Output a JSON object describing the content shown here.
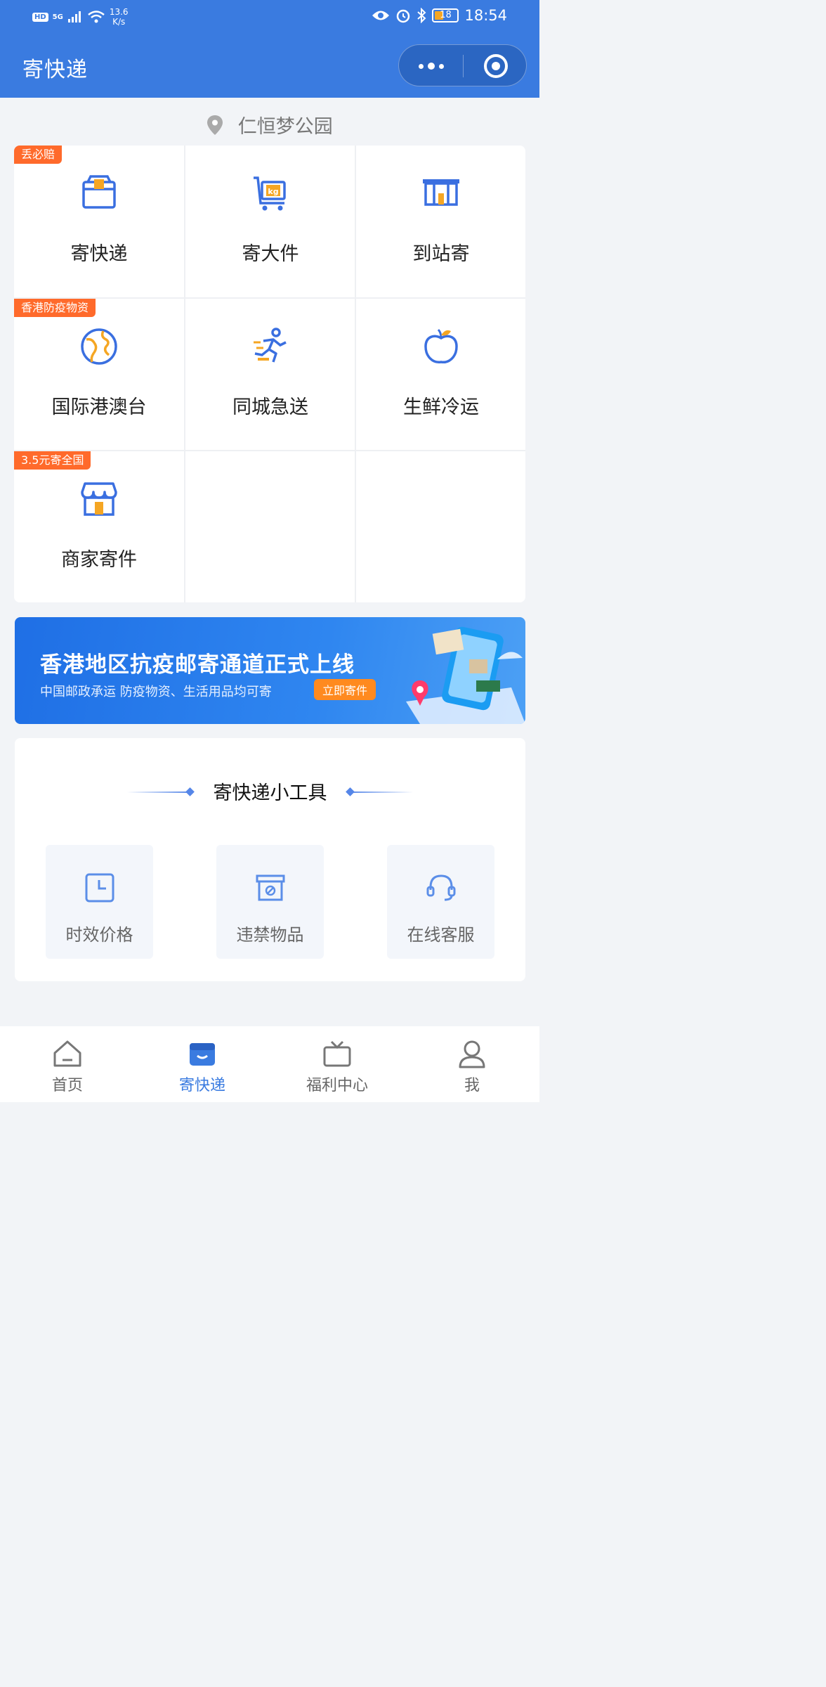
{
  "status_bar": {
    "hd": "HD",
    "network": "5G",
    "speed_top": "13.6",
    "speed_bottom": "K/s",
    "battery": "18",
    "time": "18:54"
  },
  "header": {
    "title": "寄快递"
  },
  "location": {
    "name": "仁恒梦公园"
  },
  "services": [
    {
      "label": "寄快递",
      "tag": "丢必赔",
      "icon": "box-icon"
    },
    {
      "label": "寄大件",
      "tag": "",
      "icon": "cart-kg-icon"
    },
    {
      "label": "到站寄",
      "tag": "",
      "icon": "station-icon"
    },
    {
      "label": "国际港澳台",
      "tag": "香港防疫物资",
      "icon": "globe-icon"
    },
    {
      "label": "同城急送",
      "tag": "",
      "icon": "runner-icon"
    },
    {
      "label": "生鲜冷运",
      "tag": "",
      "icon": "apple-icon"
    },
    {
      "label": "商家寄件",
      "tag": "3.5元寄全国",
      "icon": "shop-icon"
    }
  ],
  "banner": {
    "headline": "香港地区抗疫邮寄通道正式上线",
    "subline": "中国邮政承运 防疫物资、生活用品均可寄",
    "button": "立即寄件"
  },
  "tools": {
    "title": "寄快递小工具",
    "items": [
      {
        "label": "时效价格",
        "icon": "clock-icon"
      },
      {
        "label": "违禁物品",
        "icon": "prohibited-box-icon"
      },
      {
        "label": "在线客服",
        "icon": "headset-icon"
      }
    ]
  },
  "nav": [
    {
      "label": "首页",
      "icon": "home-icon",
      "active": false
    },
    {
      "label": "寄快递",
      "icon": "parcel-icon",
      "active": true
    },
    {
      "label": "福利中心",
      "icon": "gift-tv-icon",
      "active": false
    },
    {
      "label": "我",
      "icon": "user-icon",
      "active": false
    }
  ],
  "colors": {
    "brand_blue": "#3a7be0",
    "tag_orange": "#ff6a2b",
    "icon_orange": "#f5a623"
  }
}
